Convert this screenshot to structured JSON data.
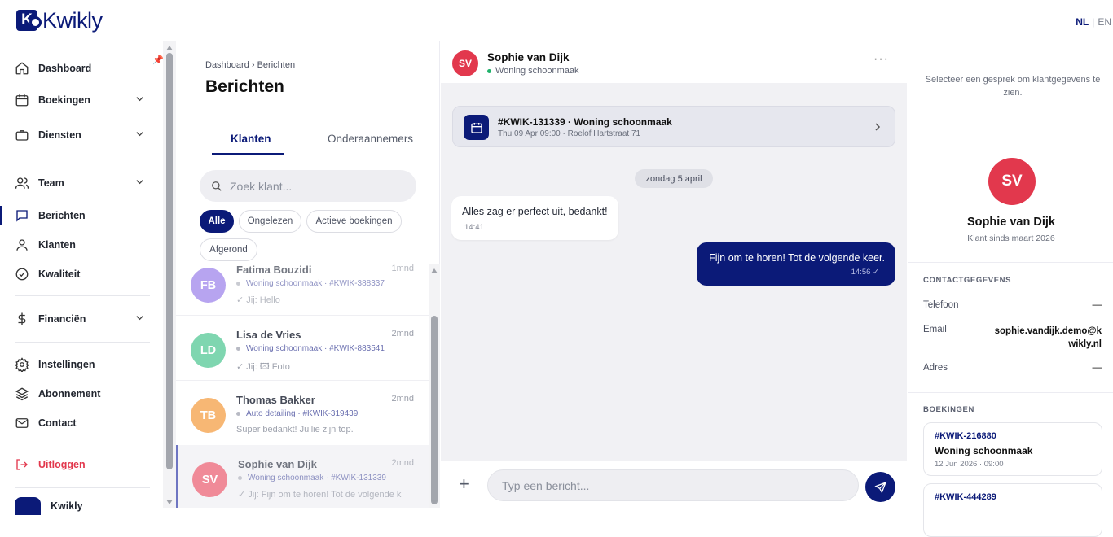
{
  "app": {
    "brand": "Kwikly",
    "brand_mark": "K",
    "lang_active": "NL",
    "lang_other": "EN",
    "lang_sep": "|"
  },
  "sidebar": {
    "items": [
      {
        "label": "Dashboard",
        "icon": "home-icon"
      },
      {
        "label": "Boekingen",
        "icon": "calendar-icon"
      },
      {
        "label": "Diensten",
        "icon": "briefcase-icon"
      },
      {
        "label": "Team",
        "icon": "users-icon"
      },
      {
        "label": "Berichten",
        "icon": "message-icon",
        "active": true
      },
      {
        "label": "Klanten",
        "icon": "user-icon"
      },
      {
        "label": "Kwaliteit",
        "icon": "check-circle-icon"
      },
      {
        "label": "Financiën",
        "icon": "dollar-icon"
      },
      {
        "label": "Instellingen",
        "icon": "gear-icon"
      },
      {
        "label": "Abonnement",
        "icon": "layers-icon"
      },
      {
        "label": "Contact",
        "icon": "mail-icon"
      },
      {
        "label": "Uitloggen",
        "icon": "logout-icon"
      }
    ],
    "account_name": "Kwikly"
  },
  "list": {
    "breadcrumb": "Dashboard › Berichten",
    "title": "Berichten",
    "tabs": [
      "Klanten",
      "Onderaannemers"
    ],
    "search_placeholder": "Zoek klant...",
    "filters": [
      "Alle",
      "Ongelezen",
      "Actieve boekingen",
      "Afgerond"
    ],
    "conversations": [
      {
        "initials": "FB",
        "name": "Fatima Bouzidi",
        "time": "1mnd",
        "meta": "Woning schoonmaak · #KWIK-388337",
        "last": "✓ Jij: Hello",
        "color": "#b7a4f0"
      },
      {
        "initials": "LD",
        "name": "Lisa de Vries",
        "time": "2mnd",
        "meta": "Woning schoonmaak · #KWIK-883541",
        "last": "✓ Jij: 🖾 Foto",
        "color": "#7fd6b0"
      },
      {
        "initials": "TB",
        "name": "Thomas Bakker",
        "time": "2mnd",
        "meta": "Auto detailing · #KWIK-319439",
        "last": "Super bedankt! Jullie zijn top.",
        "color": "#f7b774"
      },
      {
        "initials": "SV",
        "name": "Sophie van Dijk",
        "time": "2mnd",
        "meta": "Woning schoonmaak · #KWIK-131339",
        "last": "✓ Jij: Fijn om te horen! Tot de volgende k",
        "color": "#f08a98"
      }
    ]
  },
  "chat": {
    "initials": "SV",
    "name": "Sophie van Dijk",
    "subtitle": "Woning schoonmaak",
    "more": "···",
    "booking_title": "#KWIK-131339 · Woning schoonmaak",
    "booking_sub": "Thu 09 Apr 09:00 · Roelof Hartstraat 71",
    "date_pill": "zondag 5 april",
    "msg_in": {
      "text": "Alles zag er perfect uit, bedankt!",
      "time": "14:41"
    },
    "msg_out": {
      "text": "Fijn om te horen! Tot de volgende keer.",
      "time": "14:56 ✓"
    },
    "composer_placeholder": "Typ een bericht...",
    "plus": "+"
  },
  "detail": {
    "hint": "Selecteer een gesprek om klantgegevens te zien.",
    "initials": "SV",
    "name": "Sophie van Dijk",
    "since": "Klant sinds maart 2026",
    "contact_header": "CONTACTGEGEVENS",
    "phone_label": "Telefoon",
    "phone_value": "—",
    "email_label": "Email",
    "email_value": "sophie.vandijk.demo@kwikly.nl",
    "address_label": "Adres",
    "address_value": "—",
    "bookings_header": "BOEKINGEN",
    "bookings": [
      {
        "id": "#KWIK-216880",
        "type": "Woning schoonmaak",
        "date": "12 Jun 2026 · 09:00"
      },
      {
        "id": "#KWIK-444289",
        "type": "",
        "date": ""
      }
    ]
  }
}
